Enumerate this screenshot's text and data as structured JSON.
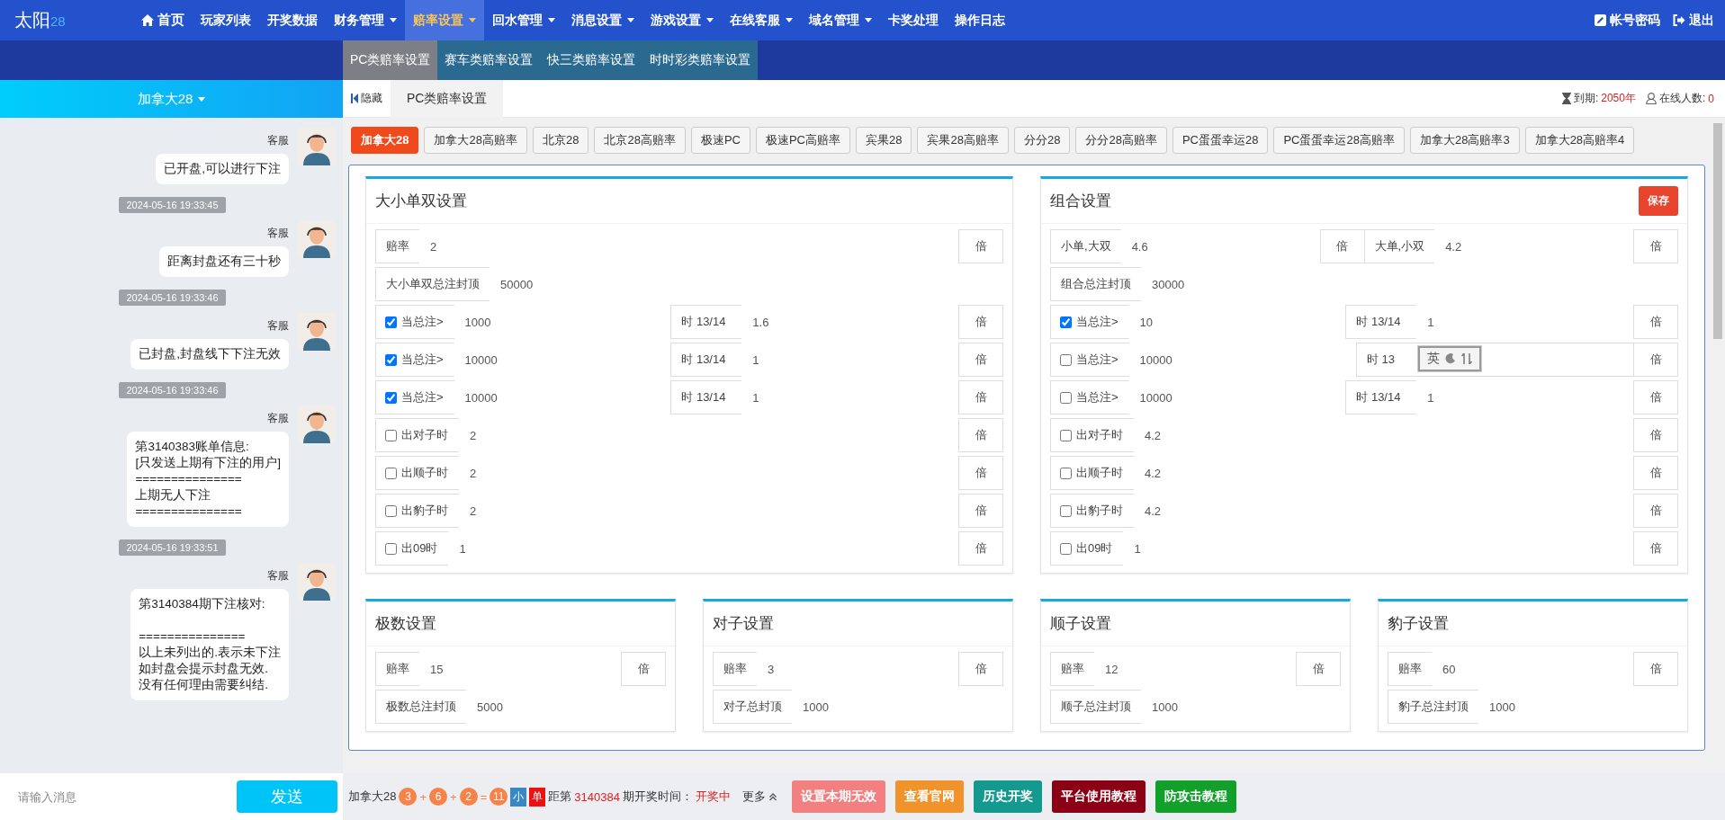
{
  "nav": {
    "brand": "太阳",
    "brand_sub": "28",
    "items": [
      {
        "label": "首页",
        "dropdown": false,
        "selected": false
      },
      {
        "label": "玩家列表",
        "dropdown": false,
        "selected": false
      },
      {
        "label": "开奖数据",
        "dropdown": false,
        "selected": false
      },
      {
        "label": "财务管理",
        "dropdown": true,
        "selected": false
      },
      {
        "label": "赔率设置",
        "dropdown": true,
        "selected": true
      },
      {
        "label": "回水管理",
        "dropdown": true,
        "selected": false
      },
      {
        "label": "消息设置",
        "dropdown": true,
        "selected": false
      },
      {
        "label": "游戏设置",
        "dropdown": true,
        "selected": false
      },
      {
        "label": "在线客服",
        "dropdown": true,
        "selected": false
      },
      {
        "label": "域名管理",
        "dropdown": true,
        "selected": false
      },
      {
        "label": "卡奖处理",
        "dropdown": false,
        "selected": false
      },
      {
        "label": "操作日志",
        "dropdown": false,
        "selected": false
      }
    ],
    "actions": [
      {
        "label": "帐号密码"
      },
      {
        "label": "退出"
      }
    ]
  },
  "submenu": [
    {
      "label": "PC类赔率设置",
      "selected": true
    },
    {
      "label": "赛车类赔率设置",
      "selected": false
    },
    {
      "label": "快三类赔率设置",
      "selected": false
    },
    {
      "label": "时时彩类赔率设置",
      "selected": false
    }
  ],
  "chat": {
    "title": "加拿大28",
    "messages": [
      {
        "kind": "message",
        "sender": "客服",
        "lines": [
          "已开盘,可以进行下注"
        ]
      },
      {
        "kind": "time",
        "text": "2024-05-16 19:33:45"
      },
      {
        "kind": "message",
        "sender": "客服",
        "lines": [
          "距离封盘还有三十秒"
        ]
      },
      {
        "kind": "time",
        "text": "2024-05-16 19:33:46"
      },
      {
        "kind": "message",
        "sender": "客服",
        "lines": [
          "已封盘,封盘线下下注无效"
        ]
      },
      {
        "kind": "time",
        "text": "2024-05-16 19:33:46"
      },
      {
        "kind": "message",
        "sender": "客服",
        "lines": [
          "第3140383账单信息:",
          "[只发送上期有下注的用户]",
          "===============",
          "上期无人下注",
          "==============="
        ]
      },
      {
        "kind": "time",
        "text": "2024-05-16 19:33:51"
      },
      {
        "kind": "message",
        "sender": "客服",
        "lines": [
          "第3140384期下注核对:",
          "===============",
          "以上未列出的.表示未下注",
          "如封盘会提示封盘无效.",
          "没有任何理由需要纠结."
        ]
      }
    ],
    "input": {
      "placeholder": "请输入消息"
    },
    "send": "发送"
  },
  "toolbar": {
    "hide": "隐藏",
    "tab": "PC类赔率设置",
    "expiry_label": "到期:",
    "expiry": "2050年",
    "online_label": "在线人数:",
    "online": "0"
  },
  "games": [
    {
      "label": "加拿大28",
      "selected": true
    },
    {
      "label": "加拿大28高赔率",
      "selected": false
    },
    {
      "label": "北京28",
      "selected": false
    },
    {
      "label": "北京28高赔率",
      "selected": false
    },
    {
      "label": "极速PC",
      "selected": false
    },
    {
      "label": "极速PC高赔率",
      "selected": false
    },
    {
      "label": "宾果28",
      "selected": false
    },
    {
      "label": "宾果28高赔率",
      "selected": false
    },
    {
      "label": "分分28",
      "selected": false
    },
    {
      "label": "分分28高赔率",
      "selected": false
    },
    {
      "label": "PC蛋蛋幸运28",
      "selected": false
    },
    {
      "label": "PC蛋蛋幸运28高赔率",
      "selected": false
    },
    {
      "label": "加拿大28高赔率3",
      "selected": false
    },
    {
      "label": "加拿大28高赔率4",
      "selected": false
    }
  ],
  "panels": [
    {
      "title": "大小单双设置",
      "rows": [
        {
          "kind": "field",
          "label": "赔率",
          "value": "2",
          "unit": "倍"
        },
        {
          "kind": "field",
          "label": "大小单双总注封顶",
          "value": "50000"
        },
        {
          "kind": "threshold",
          "checked": true,
          "label": "当总注>",
          "value": "1000",
          "label2": "时 13/14",
          "value2": "1.6",
          "unit": "倍"
        },
        {
          "kind": "threshold",
          "checked": true,
          "label": "当总注>",
          "value": "10000",
          "label2": "时 13/14",
          "value2": "1",
          "unit": "倍"
        },
        {
          "kind": "threshold",
          "checked": true,
          "label": "当总注>",
          "value": "10000",
          "label2": "时 13/14",
          "value2": "1",
          "unit": "倍"
        },
        {
          "kind": "check",
          "checked": false,
          "label": "出对子时",
          "value": "2",
          "unit": "倍"
        },
        {
          "kind": "check",
          "checked": false,
          "label": "出顺子时",
          "value": "2",
          "unit": "倍"
        },
        {
          "kind": "check",
          "checked": false,
          "label": "出豹子时",
          "value": "2",
          "unit": "倍"
        },
        {
          "kind": "check",
          "checked": false,
          "label": "出09时",
          "value": "1",
          "unit": "倍"
        }
      ]
    },
    {
      "title": "组合设置",
      "save": "保存",
      "rows": [
        {
          "kind": "pair",
          "items": [
            {
              "label": "小单,大双",
              "value": "4.6",
              "unit": "倍"
            },
            {
              "label": "大单,小双",
              "value": "4.2",
              "unit": "倍"
            }
          ]
        },
        {
          "kind": "field",
          "label": "组合总注封顶",
          "value": "30000"
        },
        {
          "kind": "threshold",
          "checked": true,
          "label": "当总注>",
          "value": "10",
          "label2": "时 13/14",
          "value2": "1",
          "unit": "倍"
        },
        {
          "kind": "threshold",
          "checked": false,
          "label": "当总注>",
          "value": "10000",
          "label2": "时 13",
          "ime": "英",
          "unit": "倍"
        },
        {
          "kind": "threshold",
          "checked": false,
          "label": "当总注>",
          "value": "10000",
          "label2": "时 13/14",
          "value2": "1",
          "unit": "倍"
        },
        {
          "kind": "check",
          "checked": false,
          "label": "出对子时",
          "value": "4.2",
          "unit": "倍"
        },
        {
          "kind": "check",
          "checked": false,
          "label": "出顺子时",
          "value": "4.2",
          "unit": "倍"
        },
        {
          "kind": "check",
          "checked": false,
          "label": "出豹子时",
          "value": "4.2",
          "unit": "倍"
        },
        {
          "kind": "check",
          "checked": false,
          "label": "出09时",
          "value": "1",
          "unit": "倍"
        }
      ]
    },
    {
      "title": "极数设置",
      "rows": [
        {
          "kind": "field",
          "label": "赔率",
          "value": "15",
          "unit": "倍"
        },
        {
          "kind": "field",
          "label": "极数总注封顶",
          "value": "5000"
        }
      ]
    },
    {
      "title": "对子设置",
      "rows": [
        {
          "kind": "field",
          "label": "赔率",
          "value": "3",
          "unit": "倍"
        },
        {
          "kind": "field",
          "label": "对子总封顶",
          "value": "1000"
        }
      ]
    },
    {
      "title": "顺子设置",
      "rows": [
        {
          "kind": "field",
          "label": "赔率",
          "value": "12",
          "unit": "倍"
        },
        {
          "kind": "field",
          "label": "顺子总注封顶",
          "value": "1000"
        }
      ]
    },
    {
      "title": "豹子设置",
      "rows": [
        {
          "kind": "field",
          "label": "赔率",
          "value": "60",
          "unit": "倍"
        },
        {
          "kind": "field",
          "label": "豹子总注封顶",
          "value": "1000"
        }
      ]
    }
  ],
  "draw_bar": {
    "game": "加拿大28",
    "result": [
      {
        "kind": "ball",
        "text": "3"
      },
      {
        "kind": "op",
        "text": "+"
      },
      {
        "kind": "ball",
        "text": "6"
      },
      {
        "kind": "op",
        "text": "+"
      },
      {
        "kind": "ball",
        "text": "2"
      },
      {
        "kind": "op",
        "text": "="
      },
      {
        "kind": "ball",
        "text": "11"
      },
      {
        "kind": "tag",
        "text": "小",
        "color": "#3a87c8"
      },
      {
        "kind": "tag",
        "text": "单",
        "color": "#ee1111"
      }
    ],
    "period_prefix": "距第",
    "period": "3140384",
    "period_suffix": "期开奖时间：",
    "status": "开奖中",
    "more": "更多",
    "buttons": [
      {
        "label": "设置本期无效",
        "color": "#f28080"
      },
      {
        "label": "查看官网",
        "color": "#f0932b"
      },
      {
        "label": "历史开奖",
        "color": "#14998e"
      },
      {
        "label": "平台使用教程",
        "color": "#8b0014"
      },
      {
        "label": "防攻击教程",
        "color": "#12a02a"
      }
    ]
  }
}
